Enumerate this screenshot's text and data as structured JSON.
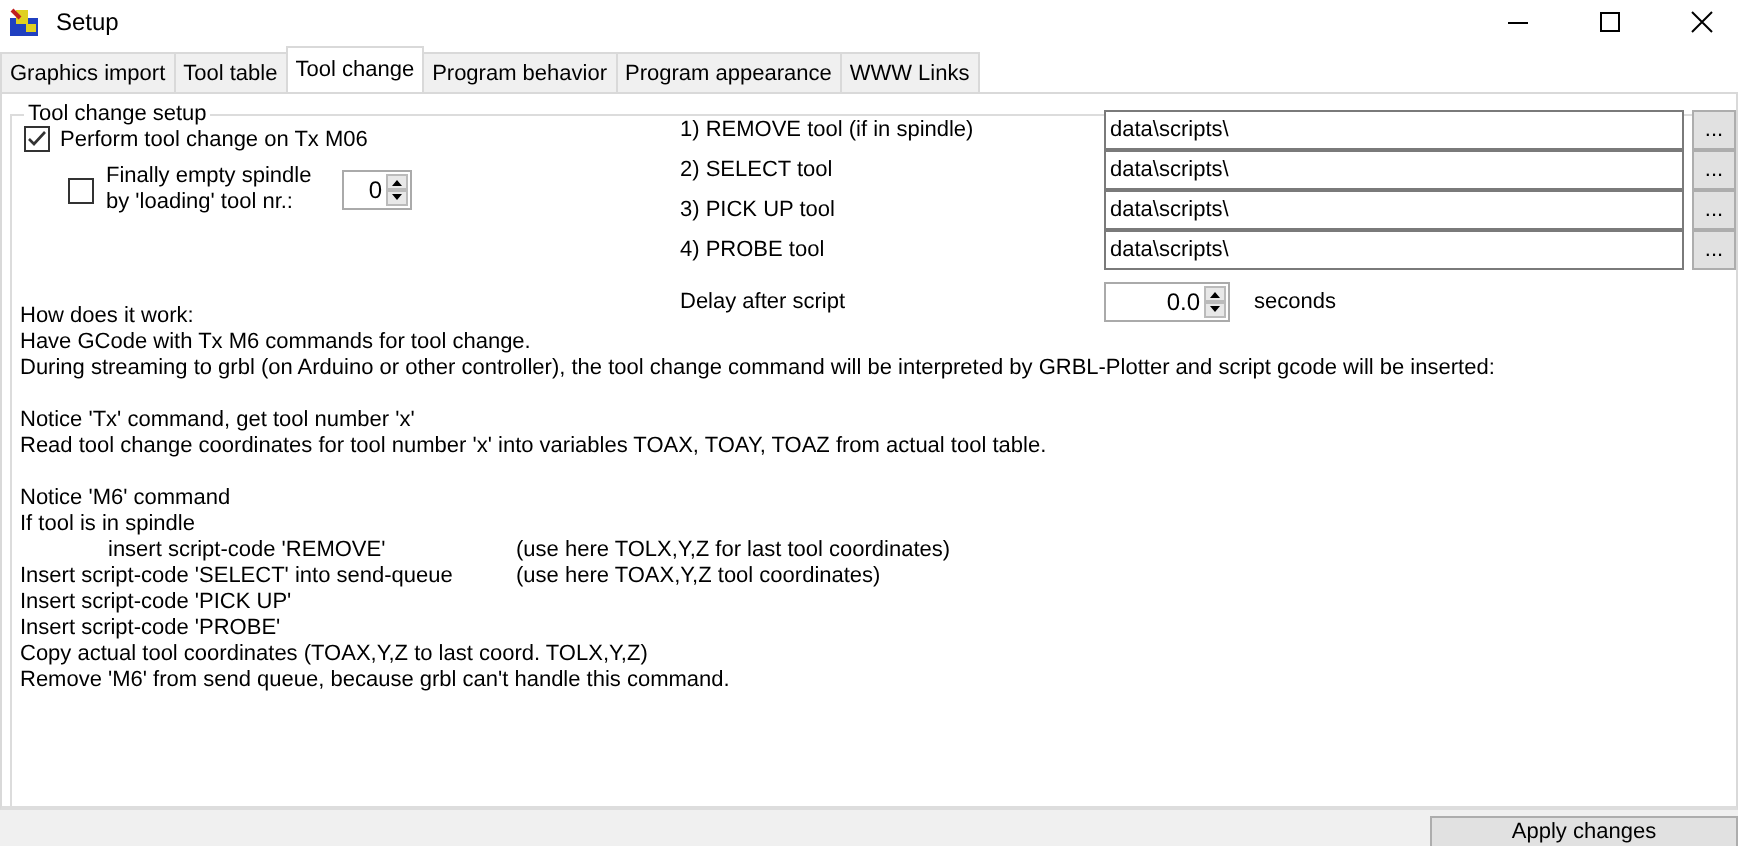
{
  "window": {
    "title": "Setup"
  },
  "tabs": [
    {
      "label": "Graphics import",
      "selected": false
    },
    {
      "label": "Tool table",
      "selected": false
    },
    {
      "label": "Tool change",
      "selected": true
    },
    {
      "label": "Program behavior",
      "selected": false
    },
    {
      "label": "Program appearance",
      "selected": false
    },
    {
      "label": "WWW Links",
      "selected": false
    }
  ],
  "group": {
    "title": "Tool change setup",
    "perform": {
      "label": "Perform tool change on Tx M06",
      "checked": true
    },
    "empty_spindle": {
      "label": "Finally empty spindle by 'loading' tool nr.:",
      "checked": false,
      "value": "0"
    },
    "scripts": [
      {
        "label": "1) REMOVE tool (if in spindle)",
        "value": "data\\scripts\\",
        "button": "..."
      },
      {
        "label": "2) SELECT tool",
        "value": "data\\scripts\\",
        "button": "..."
      },
      {
        "label": "3) PICK UP tool",
        "value": "data\\scripts\\",
        "button": "..."
      },
      {
        "label": "4) PROBE tool",
        "value": "data\\scripts\\",
        "button": "..."
      }
    ],
    "delay": {
      "label": "Delay after script",
      "value": "0.0",
      "unit": "seconds"
    },
    "help": [
      [
        {
          "text": "How does it work:",
          "indented": false
        },
        {
          "text": "Have GCode with Tx M6 commands for tool change.",
          "indented": false
        },
        {
          "text": "During streaming to grbl (on Arduino or other controller), the tool change command will be interpreted by GRBL-Plotter and script gcode will be inserted:",
          "indented": false
        }
      ],
      [
        {
          "text": "Notice 'Tx' command, get tool number 'x'",
          "indented": false
        },
        {
          "text": "Read tool change coordinates for tool number 'x' into variables TOAX, TOAY, TOAZ from actual tool table.",
          "indented": false
        }
      ],
      [
        {
          "text": "Notice 'M6' command",
          "indented": false
        },
        {
          "text": "If tool is in spindle",
          "indented": false
        },
        {
          "text": "insert script-code 'REMOVE'",
          "indented": true,
          "note": "(use here TOLX,Y,Z for last tool coordinates)"
        },
        {
          "text": "Insert script-code 'SELECT' into send-queue",
          "indented": false,
          "note": "(use here TOAX,Y,Z tool coordinates)"
        },
        {
          "text": "Insert script-code 'PICK UP'",
          "indented": false
        },
        {
          "text": "Insert script-code 'PROBE'",
          "indented": false
        },
        {
          "text": "Copy actual tool coordinates (TOAX,Y,Z to last coord. TOLX,Y,Z)",
          "indented": false
        },
        {
          "text": "Remove 'M6' from send queue, because grbl can't handle this command.",
          "indented": false
        }
      ]
    ]
  },
  "apply_button": "Apply changes"
}
